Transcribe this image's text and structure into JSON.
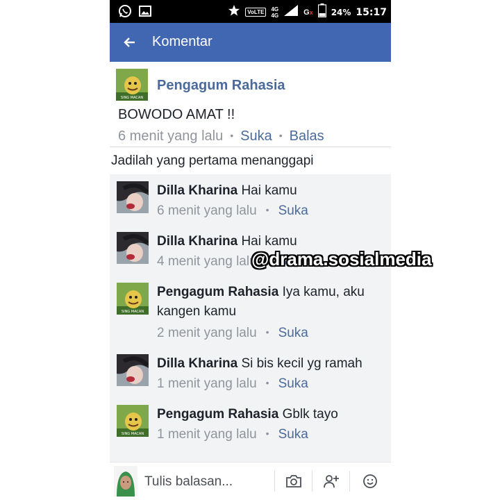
{
  "status_bar": {
    "volte": "VoLTE",
    "network_top": "4G",
    "network_bottom": "4G",
    "g_label": "G",
    "g_x": "x",
    "battery": "24%",
    "time": "15:17",
    "icons": [
      "whatsapp-icon",
      "gallery-icon",
      "star-icon",
      "signal-icon",
      "battery-icon"
    ]
  },
  "header": {
    "title": "Komentar",
    "back_icon": "arrow-left-icon"
  },
  "comment": {
    "author": "Pengagum Rahasia",
    "avatar_caption": "SING MACAN",
    "text": "BOWODO AMAT !!",
    "time": "6 menit yang lalu",
    "like": "Suka",
    "reply": "Balas"
  },
  "first_reply_prompt": "Jadilah yang pertama menanggapi",
  "replies": [
    {
      "author": "Dilla Kharina",
      "text": "Hai kamu",
      "time": "6 menit yang lalu",
      "like": "Suka"
    },
    {
      "author": "Dilla Kharina",
      "text": "Hai kamu",
      "time": "4 menit yang lalu",
      "like": "Suka"
    },
    {
      "author": "Pengagum Rahasia",
      "text": "Iya kamu, aku kangen kamu",
      "time": "2 menit yang lalu",
      "like": "Suka"
    },
    {
      "author": "Dilla Kharina",
      "text": "Si bis kecil yg ramah",
      "time": "1 menit yang lalu",
      "like": "Suka"
    },
    {
      "author": "Pengagum Rahasia",
      "text": "Gblk tayo",
      "time": "1 menit yang lalu",
      "like": "Suka"
    }
  ],
  "composer": {
    "placeholder": "Tulis balasan...",
    "icons": [
      "camera-icon",
      "add-friend-icon",
      "emoji-icon"
    ]
  },
  "watermark": "@drama.sosialmedia",
  "colors": {
    "header_bg": "#4267b2",
    "link": "#4b6a9b",
    "meta": "#90949c",
    "replies_bg": "#f2f3f5"
  }
}
